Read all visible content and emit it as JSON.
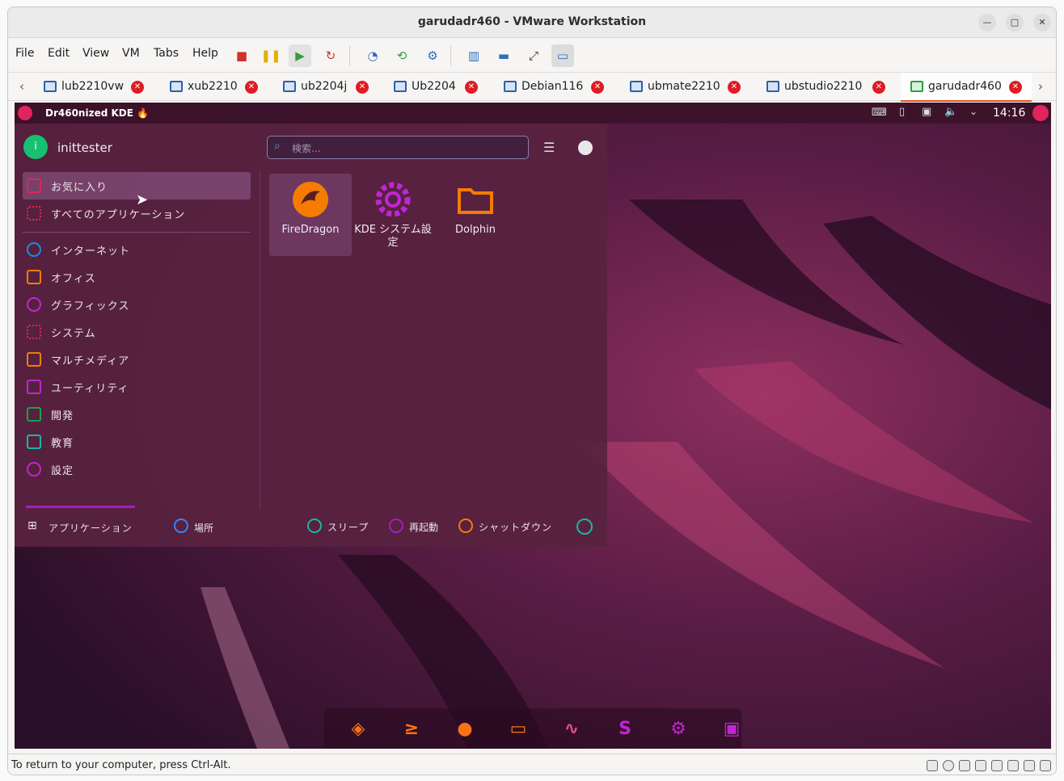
{
  "window": {
    "title": "garudadr460 - VMware Workstation"
  },
  "menubar": {
    "items": [
      "File",
      "Edit",
      "View",
      "VM",
      "Tabs",
      "Help"
    ]
  },
  "tabs": [
    {
      "label": "lub2210vw"
    },
    {
      "label": "xub2210"
    },
    {
      "label": "ub2204j"
    },
    {
      "label": "Ub2204"
    },
    {
      "label": "Debian116"
    },
    {
      "label": "ubmate2210"
    },
    {
      "label": "ubstudio2210"
    },
    {
      "label": "garudadr460",
      "active": true
    }
  ],
  "guest": {
    "panel": {
      "title": "Dr460nized KDE 🔥",
      "clock": "14:16"
    },
    "launcher": {
      "username": "inittester",
      "avatar_letter": "i",
      "search_placeholder": "検索...",
      "categories": [
        {
          "label": "お気に入り",
          "icon": "bookmark-icon",
          "color": "#e0245e",
          "selected": true
        },
        {
          "label": "すべてのアプリケーション",
          "icon": "grid-icon",
          "color": "#e0245e"
        },
        {
          "label": "インターネット",
          "icon": "globe-icon",
          "color": "#1e88e5"
        },
        {
          "label": "オフィス",
          "icon": "office-icon",
          "color": "#f57c00"
        },
        {
          "label": "グラフィックス",
          "icon": "palette-icon",
          "color": "#c026d3"
        },
        {
          "label": "システム",
          "icon": "system-icon",
          "color": "#e0245e"
        },
        {
          "label": "マルチメディア",
          "icon": "multimedia-icon",
          "color": "#f57c00"
        },
        {
          "label": "ユーティリティ",
          "icon": "utility-icon",
          "color": "#c026d3"
        },
        {
          "label": "開発",
          "icon": "development-icon",
          "color": "#16a34a"
        },
        {
          "label": "教育",
          "icon": "education-icon",
          "color": "#14b8a6"
        },
        {
          "label": "設定",
          "icon": "settings-icon",
          "color": "#c026d3"
        }
      ],
      "favorites": [
        {
          "label": "FireDragon",
          "icon": "firedragon-icon"
        },
        {
          "label": "KDE システム設定",
          "icon": "kde-settings-icon"
        },
        {
          "label": "Dolphin",
          "icon": "folder-icon"
        }
      ],
      "footer": {
        "applications": "アプリケーション",
        "places": "場所",
        "sleep": "スリープ",
        "restart": "再起動",
        "shutdown": "シャットダウン"
      }
    },
    "dock": [
      {
        "name": "garuda-icon",
        "glyph": "◈",
        "color": "#f97316"
      },
      {
        "name": "terminal-icon",
        "glyph": "≥",
        "color": "#f97316"
      },
      {
        "name": "firedragon-icon",
        "glyph": "●",
        "color": "#f97316"
      },
      {
        "name": "folder-icon",
        "glyph": "▭",
        "color": "#f97316"
      },
      {
        "name": "system-monitor-icon",
        "glyph": "∿",
        "color": "#ec4899"
      },
      {
        "name": "store-icon",
        "glyph": "S",
        "color": "#c026d3"
      },
      {
        "name": "settings-icon",
        "glyph": "⚙",
        "color": "#c026d3"
      },
      {
        "name": "bag-icon",
        "glyph": "▣",
        "color": "#c026d3"
      }
    ]
  },
  "statusbar": {
    "text": "To return to your computer, press Ctrl-Alt."
  }
}
